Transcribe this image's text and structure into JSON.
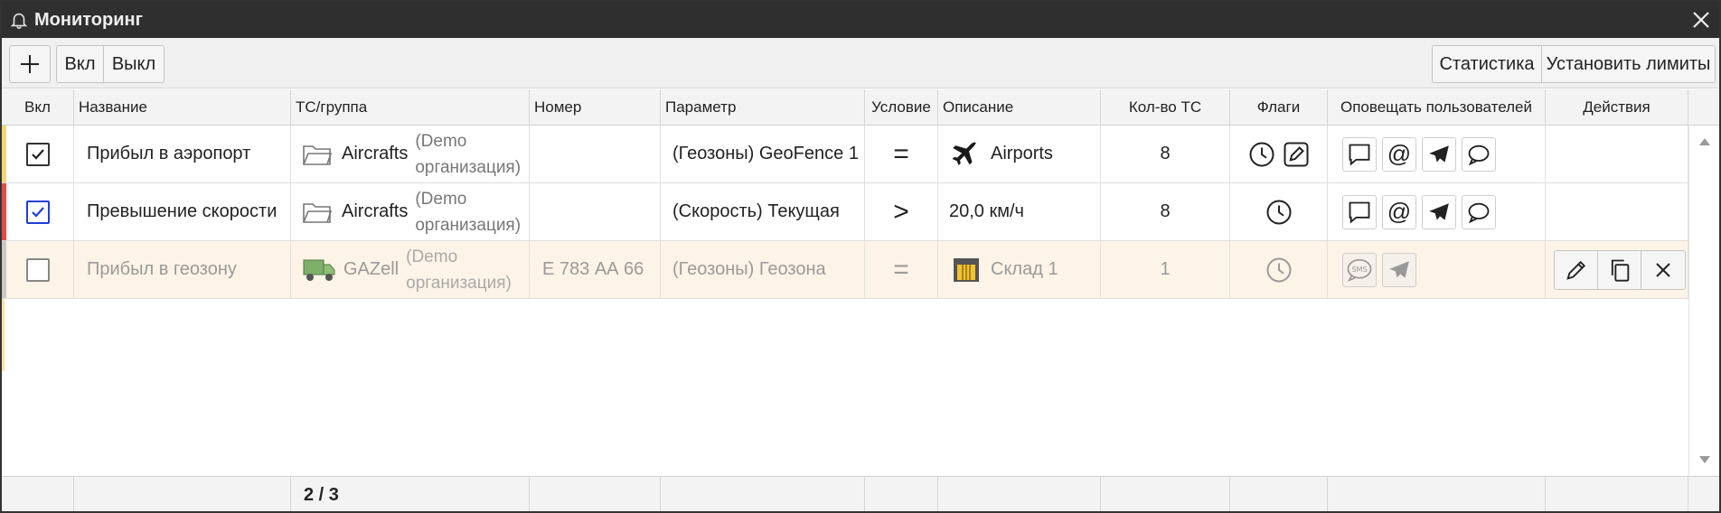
{
  "window": {
    "title": "Мониторинг"
  },
  "toolbar": {
    "add_label": "+",
    "on_label": "Вкл",
    "off_label": "Выкл",
    "stats_label": "Статистика",
    "limits_label": "Установить лимиты"
  },
  "columns": {
    "enabled": "Вкл",
    "name": "Название",
    "vehicle": "ТС/группа",
    "number": "Номер",
    "param": "Параметр",
    "condition": "Условие",
    "description": "Описание",
    "count": "Кол-во ТС",
    "flags": "Флаги",
    "notify": "Оповещать пользователей",
    "actions": "Действия"
  },
  "rows": [
    {
      "name": "Прибыл в аэропорт",
      "vehicle": "Aircrafts",
      "org_line1": "(Demo",
      "org_line2": "организация)",
      "number": "",
      "param": "(Геозоны) GeoFence 1",
      "condition": "=",
      "description": "Airports",
      "count": "8",
      "accent_color": "#f2d574"
    },
    {
      "name": "Превышение скорости",
      "vehicle": "Aircrafts",
      "org_line1": "(Demo",
      "org_line2": "организация)",
      "number": "",
      "param": "(Скорость) Текущая",
      "condition": ">",
      "description": "20,0 км/ч",
      "count": "8",
      "accent_color": "#e84a4a"
    },
    {
      "name": "Прибыл в геозону",
      "vehicle": "GAZell",
      "org_line1": "(Demo",
      "org_line2": "организация)",
      "number": "Е 783 АА 66",
      "param": "(Геозоны) Геозона",
      "condition": "=",
      "description": "Склад 1",
      "count": "1",
      "accent_color": "#c8c8c8"
    }
  ],
  "footer": {
    "count_text": "2 / 3"
  },
  "colors": {
    "titlebar": "#2f2f2f",
    "dim_row": "#fdf3e6",
    "checkbox_blue": "#1d3fd6"
  }
}
